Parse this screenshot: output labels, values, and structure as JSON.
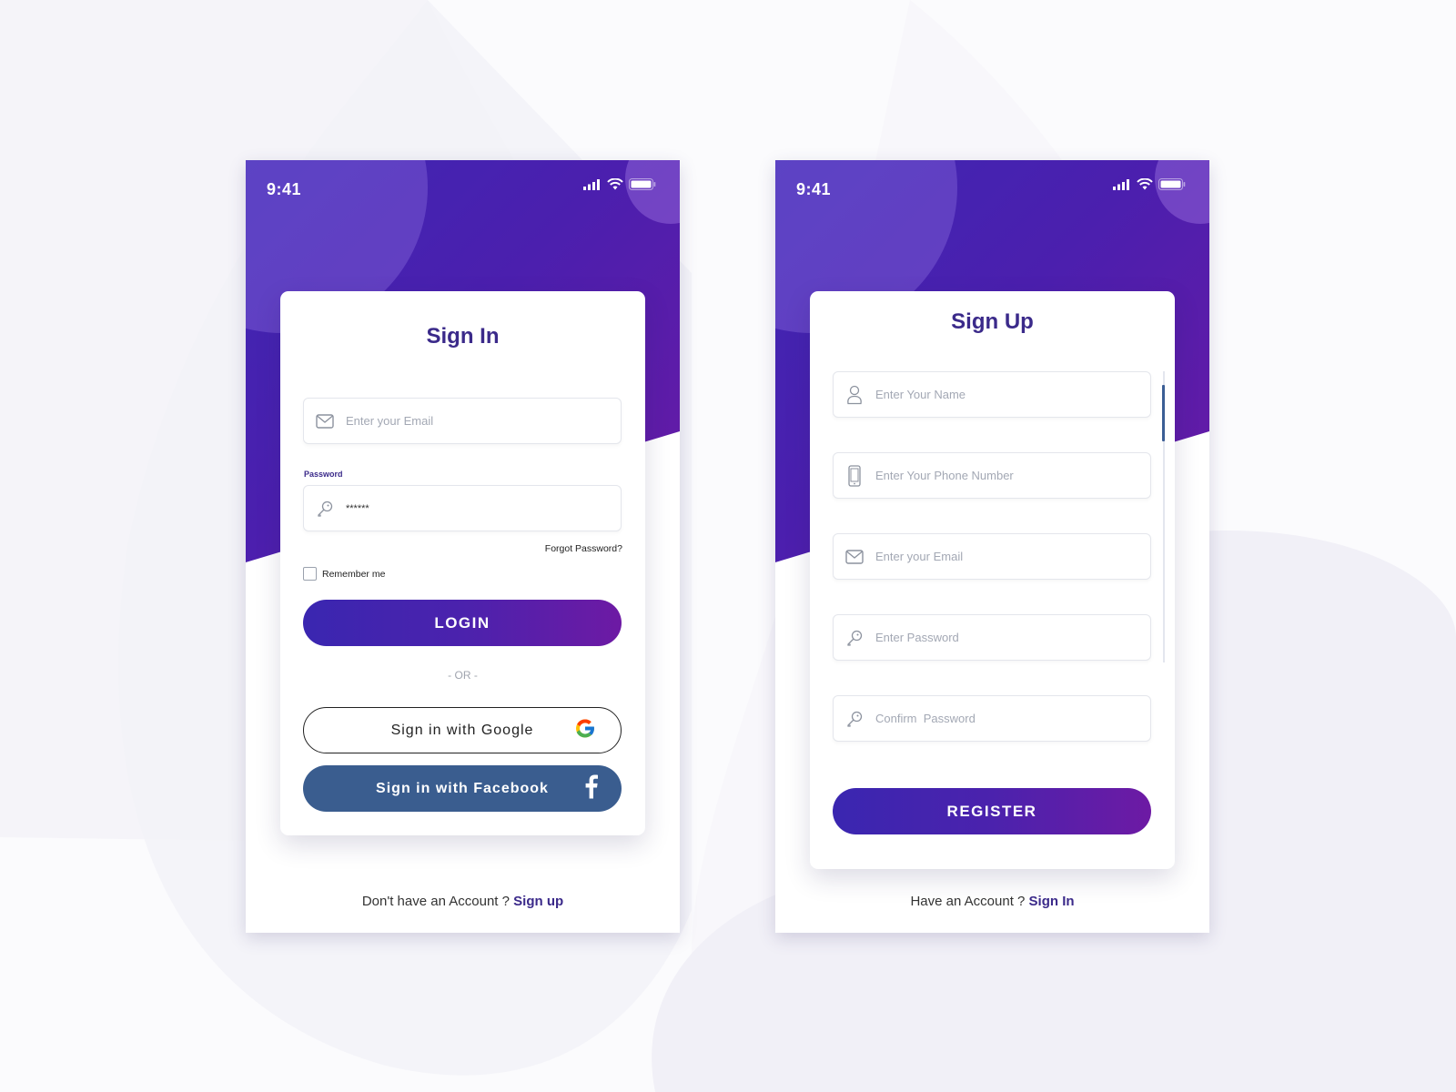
{
  "theme": {
    "primary": "#3b2a8a",
    "gradient_start": "#3a26b0",
    "gradient_end": "#6d1aa4",
    "facebook": "#3a5d8f"
  },
  "signin_screen": {
    "status_bar": {
      "time": "9:41",
      "icons": [
        "signal-icon",
        "wifi-icon",
        "battery-icon"
      ]
    },
    "title": "Sign In",
    "email_field": {
      "placeholder": "Enter your Email",
      "value": "",
      "icon": "mail-icon"
    },
    "password_label": "Password",
    "password_field": {
      "value": "******",
      "icon": "key-icon"
    },
    "forgot_password": "Forgot Password?",
    "remember_me": {
      "label": "Remember me",
      "checked": false
    },
    "login_button": "LOGIN",
    "or_divider": "- OR -",
    "google_button": {
      "label": "Sign in with Google",
      "icon": "google-icon"
    },
    "facebook_button": {
      "label": "Sign in with Facebook",
      "icon": "facebook-icon"
    },
    "footer": {
      "text": "Don't have an Account ? ",
      "link": "Sign up"
    }
  },
  "signup_screen": {
    "status_bar": {
      "time": "9:41",
      "icons": [
        "signal-icon",
        "wifi-icon",
        "battery-icon"
      ]
    },
    "title": "Sign Up",
    "fields": [
      {
        "placeholder": "Enter Your Name",
        "icon": "user-icon"
      },
      {
        "placeholder": "Enter Your Phone Number",
        "icon": "phone-icon"
      },
      {
        "placeholder": "Enter your Email",
        "icon": "mail-icon"
      },
      {
        "placeholder": "Enter Password",
        "icon": "key-icon"
      },
      {
        "placeholder": "Confirm  Password",
        "icon": "key-icon"
      }
    ],
    "register_button": "REGISTER",
    "footer": {
      "text": "Have an Account ? ",
      "link": "Sign In"
    }
  }
}
